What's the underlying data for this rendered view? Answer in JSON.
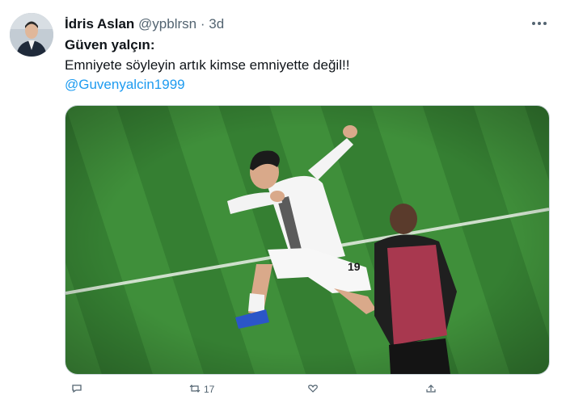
{
  "tweet": {
    "author_name": "İdris Aslan",
    "author_handle": "@ypblrsn",
    "separator": "·",
    "time": "3d",
    "body_line1": "Güven yalçın:",
    "body_line2": "Emniyete söyleyin artık kimse emniyette değil!!",
    "mention": "@Guvenyalcin1999"
  },
  "actions": {
    "retweet_count": "17"
  },
  "colors": {
    "text": "#0f1419",
    "secondary": "#536471",
    "link": "#1d9bf0",
    "pitch_light": "#3f8f3a",
    "pitch_dark": "#2f7530",
    "staff_bib": "#a8384f"
  },
  "icons": [
    "more-icon",
    "reply-icon",
    "retweet-icon",
    "like-icon",
    "share-icon"
  ],
  "media": {
    "jersey_number": "19"
  }
}
